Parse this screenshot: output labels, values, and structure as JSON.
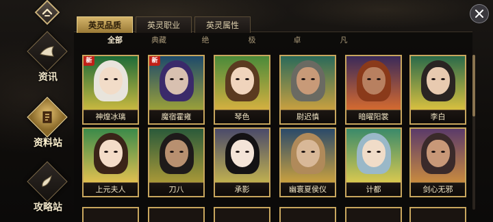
{
  "sidebar": {
    "items": [
      {
        "label": "资讯",
        "icon": "horn-icon",
        "active": false
      },
      {
        "label": "资料站",
        "icon": "scroll-icon",
        "active": true
      },
      {
        "label": "攻略站",
        "icon": "brush-icon",
        "active": false
      }
    ]
  },
  "tabs": [
    {
      "label": "英灵品质",
      "active": true
    },
    {
      "label": "英灵职业",
      "active": false
    },
    {
      "label": "英灵属性",
      "active": false
    }
  ],
  "filters": [
    {
      "label": "全部",
      "active": true
    },
    {
      "label": "典藏",
      "active": false
    },
    {
      "label": "绝",
      "active": false
    },
    {
      "label": "极",
      "active": false
    },
    {
      "label": "卓",
      "active": false
    },
    {
      "label": "凡",
      "active": false
    }
  ],
  "new_badge": "新",
  "heroes": [
    {
      "name": "神煌冰璃",
      "new": true,
      "bg": [
        "#1d6b38",
        "#c8b840"
      ],
      "hair": "#e8e4dc",
      "skin": "#f2dcc8"
    },
    {
      "name": "魔宿霍雍",
      "new": true,
      "bg": [
        "#1d4a6b",
        "#9aa03a"
      ],
      "hair": "#3a2a6a",
      "skin": "#d8c0b0"
    },
    {
      "name": "琴色",
      "new": false,
      "bg": [
        "#4a8a3a",
        "#d4b040"
      ],
      "hair": "#5a3a20",
      "skin": "#f0d4bc"
    },
    {
      "name": "尉迟慎",
      "new": false,
      "bg": [
        "#2a6a5a",
        "#c8a040"
      ],
      "hair": "#6a6a62",
      "skin": "#c89a78"
    },
    {
      "name": "暗曜阳裳",
      "new": false,
      "bg": [
        "#3a2a5a",
        "#d46a30"
      ],
      "hair": "#8a3a1a",
      "skin": "#b88060"
    },
    {
      "name": "李白",
      "new": false,
      "bg": [
        "#2a6a4a",
        "#d8c040"
      ],
      "hair": "#2a2422",
      "skin": "#e8cab0"
    },
    {
      "name": "上元夫人",
      "new": false,
      "bg": [
        "#3a8a4a",
        "#e0c050"
      ],
      "hair": "#3a2418",
      "skin": "#f4dcc8"
    },
    {
      "name": "刀八",
      "new": false,
      "bg": [
        "#2a5a3a",
        "#a89838"
      ],
      "hair": "#1e1a1a",
      "skin": "#b89070"
    },
    {
      "name": "承影",
      "new": false,
      "bg": [
        "#4a4a6a",
        "#c0b050"
      ],
      "hair": "#141214",
      "skin": "#f4e4d8"
    },
    {
      "name": "幽寰夏侯仪",
      "new": false,
      "bg": [
        "#2a4a6a",
        "#c8a040"
      ],
      "hair": "#b08a5a",
      "skin": "#d8b898"
    },
    {
      "name": "计都",
      "new": false,
      "bg": [
        "#3a8a6a",
        "#d8c850"
      ],
      "hair": "#9ab8c8",
      "skin": "#f0dcc8"
    },
    {
      "name": "剑心无邪",
      "new": false,
      "bg": [
        "#5a3a6a",
        "#c88a40"
      ],
      "hair": "#3a2a2a",
      "skin": "#c89878"
    }
  ]
}
